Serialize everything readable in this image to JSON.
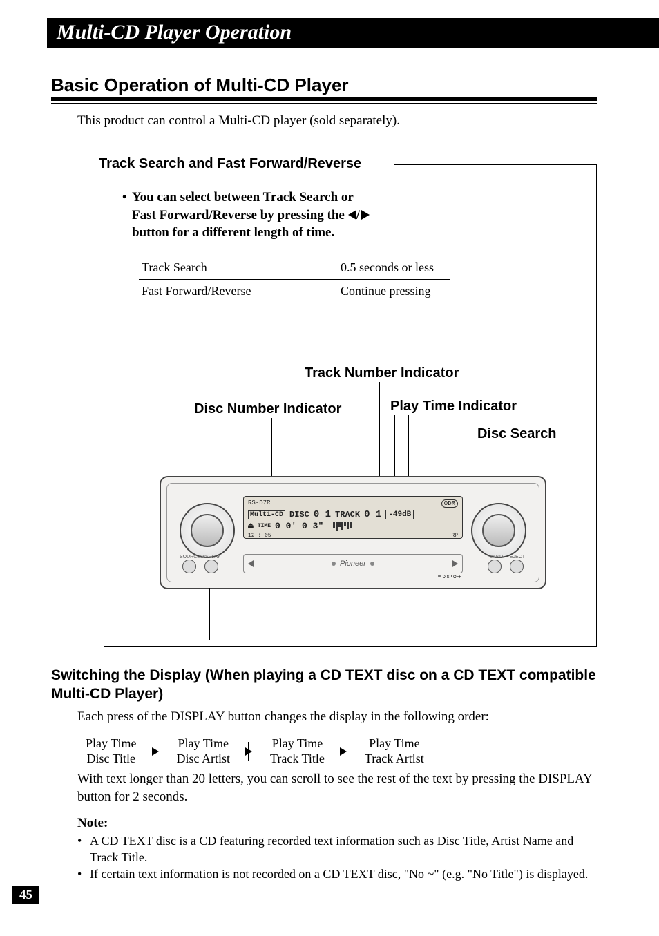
{
  "chapter_title": "Multi-CD Player Operation",
  "section_title": "Basic Operation of Multi-CD Player",
  "intro": "This product can control a Multi-CD player (sold separately).",
  "subhead_track": "Track Search and Fast Forward/Reverse",
  "bullet_line1": "You can select between Track Search or",
  "bullet_line2a": "Fast Forward/Reverse by pressing the ",
  "bullet_line2b": "/",
  "bullet_line3": "button for a different length of time.",
  "timing": {
    "r1c1": "Track Search",
    "r1c2": "0.5 seconds or less",
    "r2c1": "Fast Forward/Reverse",
    "r2c2": "Continue pressing"
  },
  "labels": {
    "track_num": "Track Number Indicator",
    "disc_num": "Disc Number Indicator",
    "play_time": "Play Time Indicator",
    "disc_search": "Disc Search"
  },
  "lcd": {
    "model": "RS-D7R",
    "odr": "ODR",
    "mode": "Multi-CD",
    "disc_lbl": "DISC",
    "disc_val": "0 1",
    "track_lbl": "TRACK",
    "track_val": "0 1",
    "db": "-49dB",
    "time_lbl": "TIME",
    "time_val": "0 0'   0 3\"",
    "clock": "12 : 05",
    "rp": "RP"
  },
  "face": {
    "brand": "Pioneer",
    "source": "SOURCE",
    "display": "DISPLAY",
    "band": "BAND",
    "eject": "EJECT",
    "dispoff": "DISP OFF"
  },
  "switching_title": "Switching the Display (When playing a CD TEXT disc on a CD TEXT compatible Multi-CD Player)",
  "switching_para": "Each press of the DISPLAY button changes the display in the following order:",
  "seq": {
    "s1a": "Play Time",
    "s1b": "Disc Title",
    "s2a": "Play Time",
    "s2b": "Disc Artist",
    "s3a": "Play Time",
    "s3b": "Track Title",
    "s4a": "Play Time",
    "s4b": "Track Artist"
  },
  "scroll_para": "With text longer than 20 letters, you can scroll to see the rest of the text by pressing the DISPLAY button for 2 seconds.",
  "note_head": "Note:",
  "note1": "A CD TEXT disc is a CD featuring recorded text information such as Disc Title, Artist Name and Track Title.",
  "note2": "If certain text information is not recorded on a CD TEXT disc, \"No ~\" (e.g. \"No Title\") is displayed.",
  "page_number": "45"
}
